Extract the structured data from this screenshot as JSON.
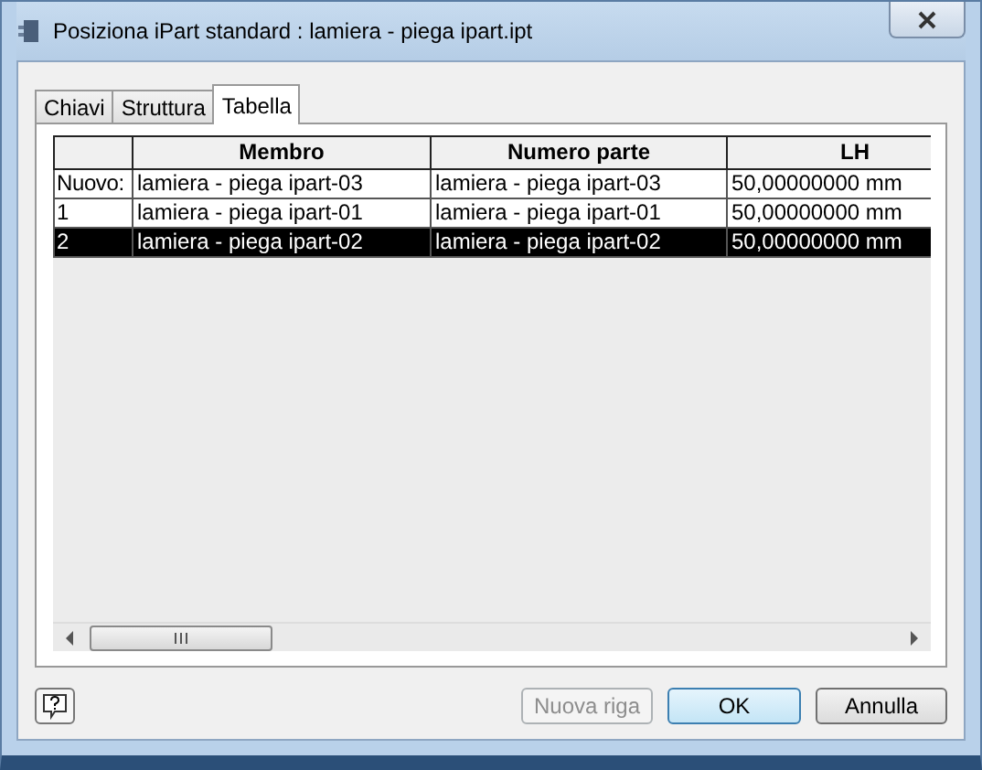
{
  "window": {
    "title": "Posiziona iPart standard : lamiera - piega ipart.ipt"
  },
  "tabs": [
    {
      "label": "Chiavi",
      "selected": false
    },
    {
      "label": "Struttura",
      "selected": false
    },
    {
      "label": "Tabella",
      "selected": true
    }
  ],
  "table": {
    "columns": [
      "Membro",
      "Numero parte",
      "LH"
    ],
    "rows": [
      {
        "header": "Nuovo:",
        "cells": [
          "lamiera - piega ipart-03",
          "lamiera - piega ipart-03",
          "50,00000000 mm"
        ],
        "selected": false
      },
      {
        "header": "1",
        "cells": [
          "lamiera - piega ipart-01",
          "lamiera - piega ipart-01",
          "50,00000000 mm"
        ],
        "selected": false
      },
      {
        "header": "2",
        "cells": [
          "lamiera - piega ipart-02",
          "lamiera - piega ipart-02",
          "50,00000000 mm"
        ],
        "selected": true
      }
    ]
  },
  "buttons": [
    {
      "label": "Nuova riga",
      "disabled": true,
      "default": false
    },
    {
      "label": "OK",
      "disabled": false,
      "default": true
    },
    {
      "label": "Annulla",
      "disabled": false,
      "default": false
    }
  ]
}
